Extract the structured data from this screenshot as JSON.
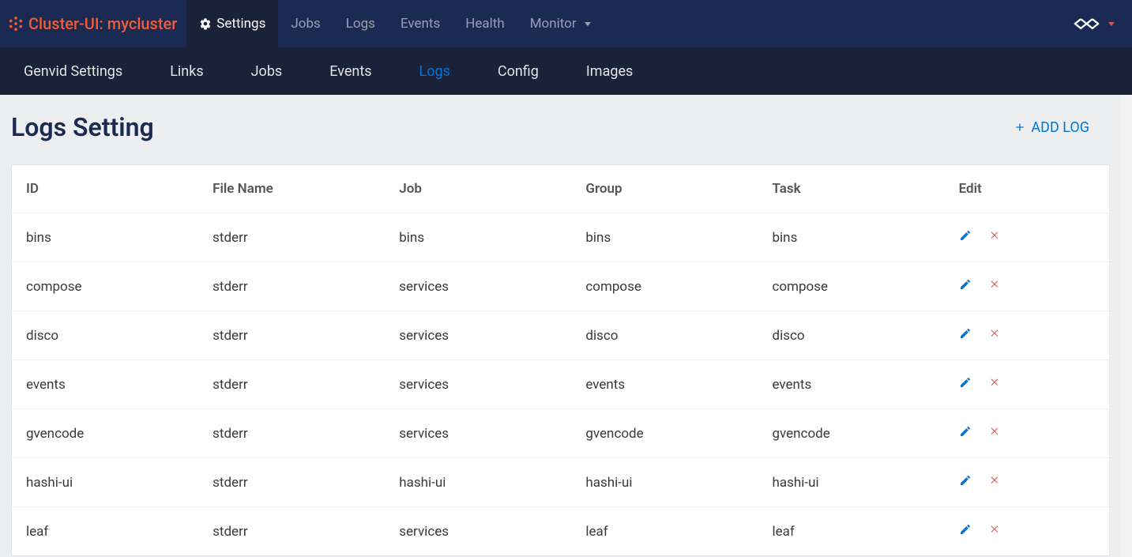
{
  "brand": {
    "label": "Cluster-UI: mycluster"
  },
  "top_nav": {
    "items": [
      {
        "label": "Settings",
        "icon": "gear",
        "active": true
      },
      {
        "label": "Jobs",
        "icon": null,
        "active": false
      },
      {
        "label": "Logs",
        "icon": null,
        "active": false
      },
      {
        "label": "Events",
        "icon": null,
        "active": false
      },
      {
        "label": "Health",
        "icon": null,
        "active": false
      },
      {
        "label": "Monitor",
        "icon": "caret",
        "active": false
      }
    ]
  },
  "sub_nav": {
    "items": [
      {
        "label": "Genvid Settings",
        "active": false
      },
      {
        "label": "Links",
        "active": false
      },
      {
        "label": "Jobs",
        "active": false
      },
      {
        "label": "Events",
        "active": false
      },
      {
        "label": "Logs",
        "active": true
      },
      {
        "label": "Config",
        "active": false
      },
      {
        "label": "Images",
        "active": false
      }
    ]
  },
  "page": {
    "title": "Logs Setting",
    "add_log_label": "ADD LOG"
  },
  "table": {
    "columns": {
      "id": "ID",
      "file": "File Name",
      "job": "Job",
      "group": "Group",
      "task": "Task",
      "edit": "Edit"
    },
    "rows": [
      {
        "id": "bins",
        "file": "stderr",
        "job": "bins",
        "group": "bins",
        "task": "bins"
      },
      {
        "id": "compose",
        "file": "stderr",
        "job": "services",
        "group": "compose",
        "task": "compose"
      },
      {
        "id": "disco",
        "file": "stderr",
        "job": "services",
        "group": "disco",
        "task": "disco"
      },
      {
        "id": "events",
        "file": "stderr",
        "job": "services",
        "group": "events",
        "task": "events"
      },
      {
        "id": "gvencode",
        "file": "stderr",
        "job": "services",
        "group": "gvencode",
        "task": "gvencode"
      },
      {
        "id": "hashi-ui",
        "file": "stderr",
        "job": "hashi-ui",
        "group": "hashi-ui",
        "task": "hashi-ui"
      },
      {
        "id": "leaf",
        "file": "stderr",
        "job": "services",
        "group": "leaf",
        "task": "leaf"
      }
    ]
  },
  "colors": {
    "nav_bg": "#1b2a52",
    "subnav_bg": "#192239",
    "accent_orange": "#f25c34",
    "link_blue": "#0275d8",
    "danger_red": "#d9534f"
  }
}
